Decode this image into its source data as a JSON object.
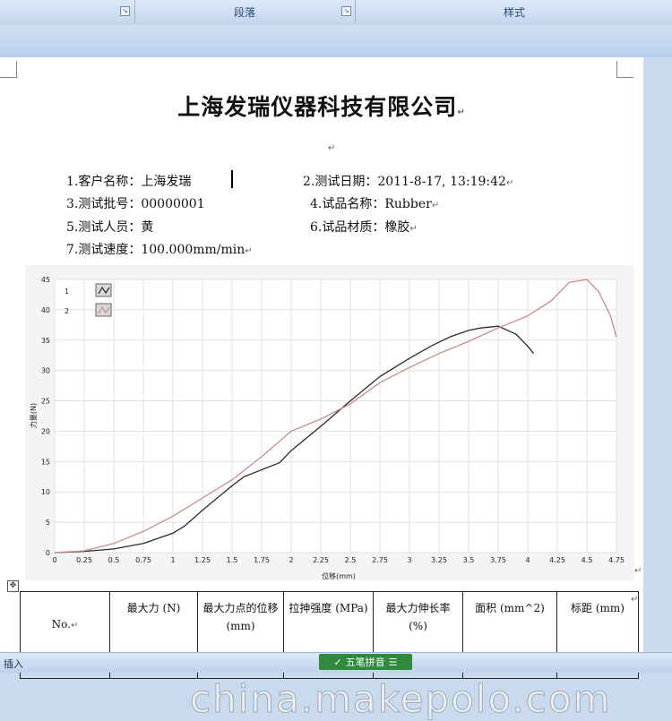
{
  "ribbon": {
    "groups": [
      {
        "label": ""
      },
      {
        "label": "段落"
      },
      {
        "label": "样式"
      }
    ]
  },
  "document": {
    "title": "上海发瑞仪器科技有限公司",
    "paragraph_mark": "↵",
    "info": [
      {
        "label": "1.客户名称：",
        "value": "上海发瑞"
      },
      {
        "label": "2.测试日期：",
        "value": "2011-8-17, 13:19:42"
      },
      {
        "label": "3.测试批号：",
        "value": "00000001"
      },
      {
        "label": "4.试品名称：",
        "value": "Rubber"
      },
      {
        "label": "5.测试人员：",
        "value": "黄"
      },
      {
        "label": "6.试品材质：",
        "value": "橡胶"
      },
      {
        "label": "7.测试速度：",
        "value": "100.000mm/min"
      }
    ]
  },
  "chart_data": {
    "type": "line",
    "xlabel": "位移(mm)",
    "ylabel": "力量(N)",
    "xlim": [
      0,
      4.75
    ],
    "ylim": [
      0,
      45
    ],
    "x_ticks": [
      "0",
      "0.25",
      "0.5",
      "0.75",
      "1",
      "1.25",
      "1.5",
      "1.75",
      "2",
      "2.25",
      "2.5",
      "2.75",
      "3",
      "3.25",
      "3.5",
      "3.75",
      "4",
      "4.25",
      "4.5",
      "4.75"
    ],
    "y_ticks": [
      "0",
      "5",
      "10",
      "15",
      "20",
      "25",
      "30",
      "35",
      "40",
      "45"
    ],
    "grid": true,
    "legend": "top-left",
    "series": [
      {
        "name": "1",
        "color": "#2a2a2a",
        "x": [
          0,
          0.25,
          0.5,
          0.75,
          1.0,
          1.1,
          1.25,
          1.5,
          1.6,
          1.9,
          2.0,
          2.25,
          2.5,
          2.75,
          3.0,
          3.2,
          3.35,
          3.5,
          3.6,
          3.75,
          3.9,
          4.0,
          4.05
        ],
        "y": [
          0,
          0.2,
          0.6,
          1.5,
          3.2,
          4.4,
          7.0,
          11.0,
          12.5,
          14.8,
          16.8,
          20.8,
          25.0,
          29.0,
          32.0,
          34.2,
          35.6,
          36.6,
          37.0,
          37.3,
          36.0,
          34.0,
          32.8
        ]
      },
      {
        "name": "2",
        "color": "#c98a8a",
        "x": [
          0,
          0.25,
          0.5,
          0.75,
          1.0,
          1.25,
          1.5,
          1.75,
          2.0,
          2.25,
          2.5,
          2.75,
          3.0,
          3.25,
          3.5,
          3.75,
          4.0,
          4.2,
          4.3,
          4.35,
          4.5,
          4.6,
          4.7,
          4.75
        ],
        "y": [
          0,
          0.3,
          1.5,
          3.5,
          6.0,
          9.0,
          12.0,
          15.8,
          20.0,
          22.0,
          24.5,
          28.0,
          30.5,
          32.8,
          34.8,
          37.0,
          39.0,
          41.5,
          43.5,
          44.5,
          45.0,
          43.0,
          39.0,
          35.5
        ]
      }
    ]
  },
  "table": {
    "headers": [
      "No.",
      "最大力 (N)",
      "最大力点的位移 (mm)",
      "拉抻强度 (MPa)",
      "最大力伸长率 (%)",
      "面积 (mm^2)",
      "标距 (mm)"
    ]
  },
  "status_bar": {
    "mode": "插入",
    "ime_label": "五笔拼音"
  },
  "watermark": "china.makepolo.com",
  "colors": {
    "ribbon": "#c4d6ee",
    "ime": "#2e8b3e",
    "series1": "#2a2a2a",
    "series2": "#c98a8a"
  }
}
